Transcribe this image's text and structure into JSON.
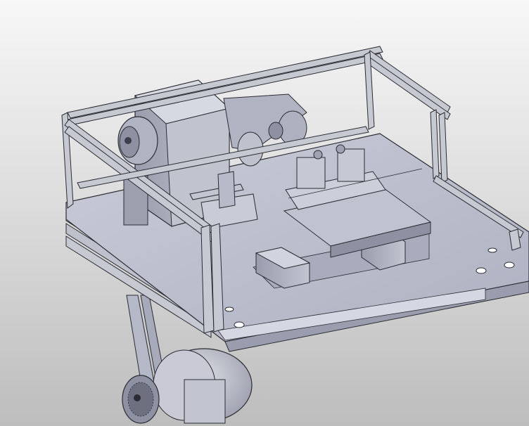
{
  "viewport": {
    "background_top": "#f7f7f7",
    "background_bottom": "#bdbdbd"
  },
  "model": {
    "part_color": "#b9bccb",
    "part_shade": "#8e91a2",
    "part_dark": "#5e6070",
    "edge_color": "#2b2c33",
    "rail_color": "#c6c8d2",
    "surface_color": "#c3c5d3"
  },
  "components": [
    {
      "name": "aluminum-extrusion-frame"
    },
    {
      "name": "base-plate"
    },
    {
      "name": "gearbox-housing"
    },
    {
      "name": "timing-pulley"
    },
    {
      "name": "pivot-arm"
    },
    {
      "name": "xy-stage"
    },
    {
      "name": "stepper-motor-left"
    },
    {
      "name": "stepper-motor-right"
    },
    {
      "name": "drive-motor"
    },
    {
      "name": "belt-drive"
    }
  ]
}
